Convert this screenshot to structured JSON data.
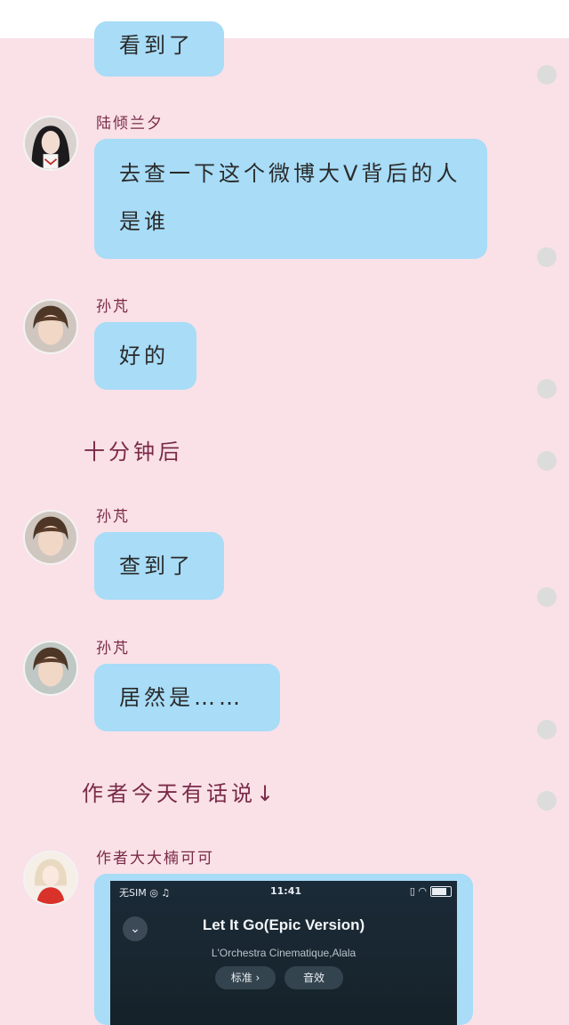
{
  "messages": [
    {
      "text": "看到了"
    },
    {
      "sender": "陆倾兰夕",
      "text": "去查一下这个微博大V背后的人是谁"
    },
    {
      "sender": "孙芃",
      "text": "好的"
    },
    {
      "narration": "十分钟后"
    },
    {
      "sender": "孙芃",
      "text": "查到了"
    },
    {
      "sender": "孙芃",
      "text": "居然是……"
    },
    {
      "narration": "作者今天有话说↓"
    },
    {
      "sender": "作者大大楠可可"
    }
  ],
  "music_card": {
    "status_left": "无SIM ◎ ♫",
    "status_time": "11:41",
    "status_right": "▯ ◠",
    "chevron": "⌄",
    "song_title": "Let It Go(Epic Version)",
    "artist": "L'Orchestra Cinematique,Alala",
    "quality_button": "标准 ›",
    "sound_button": "音效"
  },
  "colors": {
    "background": "#f9e1e7",
    "bubble": "#a8dcf7",
    "name_text": "#7a2a48",
    "dot": "#dcdcdc"
  },
  "icons": {
    "avatar_1": "avatar-girl-dark-hair",
    "avatar_2": "avatar-boy-brown-hair",
    "avatar_3": "avatar-anime-girl-red"
  }
}
